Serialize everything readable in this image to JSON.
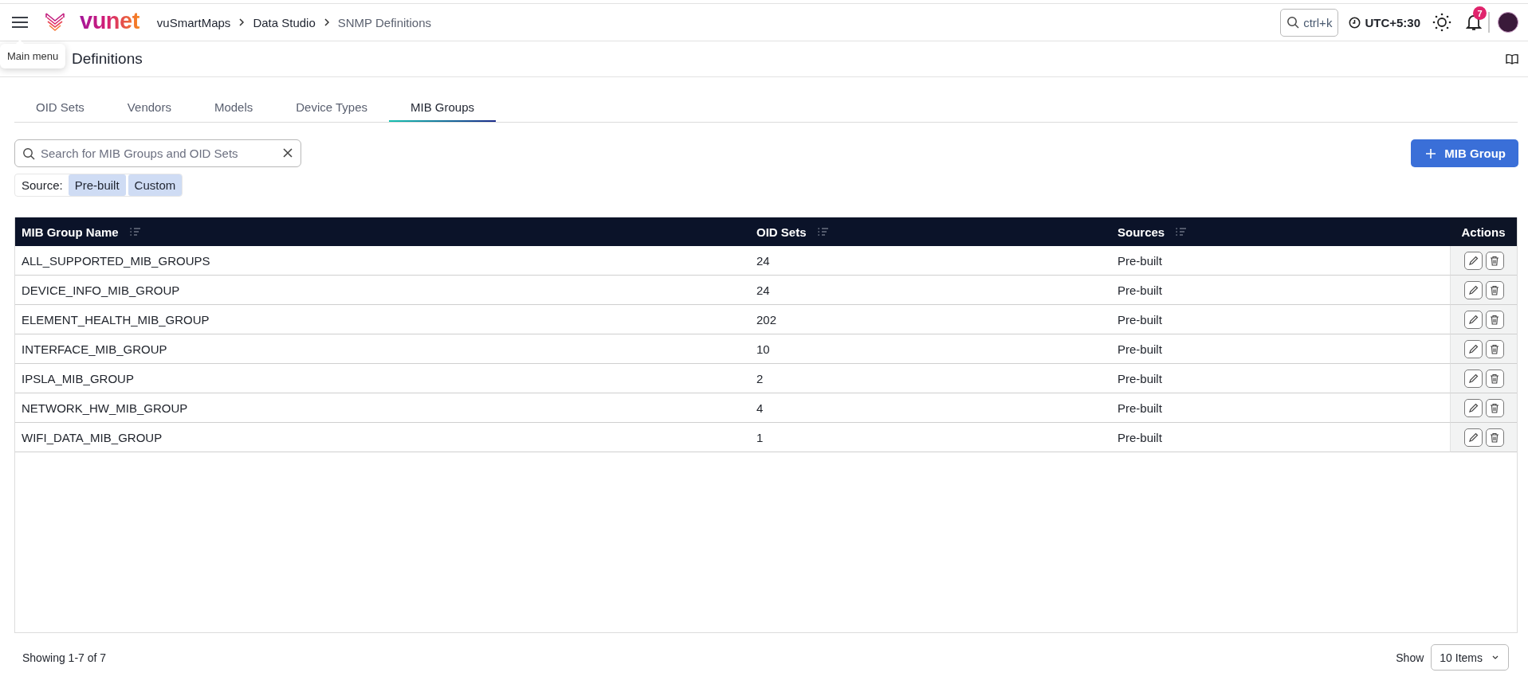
{
  "header": {
    "menu_tooltip": "Main menu",
    "logo": "vunet",
    "breadcrumbs": [
      {
        "label": "vuSmartMaps",
        "current": false
      },
      {
        "label": "Data Studio",
        "current": false
      },
      {
        "label": "SNMP Definitions",
        "current": true
      }
    ],
    "search_shortcut": "ctrl+k",
    "timezone": "UTC+5:30",
    "notification_count": "7"
  },
  "page": {
    "title": "Definitions"
  },
  "tabs": [
    {
      "label": "OID Sets",
      "selected": false
    },
    {
      "label": "Vendors",
      "selected": false
    },
    {
      "label": "Models",
      "selected": false
    },
    {
      "label": "Device Types",
      "selected": false
    },
    {
      "label": "MIB Groups",
      "selected": true
    }
  ],
  "search": {
    "placeholder": "Search for MIB Groups and OID Sets"
  },
  "source_filter": {
    "label": "Source:",
    "options": [
      {
        "label": "Pre-built",
        "selected": true
      },
      {
        "label": "Custom",
        "selected": true
      }
    ]
  },
  "add_button": {
    "label": "MIB Group"
  },
  "table": {
    "columns": [
      {
        "label": "MIB Group Name",
        "sortable": true
      },
      {
        "label": "OID Sets",
        "sortable": true
      },
      {
        "label": "Sources",
        "sortable": true
      },
      {
        "label": "Actions",
        "sortable": false
      }
    ],
    "rows": [
      {
        "cells": [
          "ALL_SUPPORTED_MIB_GROUPS",
          "24",
          "Pre-built"
        ]
      },
      {
        "cells": [
          "DEVICE_INFO_MIB_GROUP",
          "24",
          "Pre-built"
        ]
      },
      {
        "cells": [
          "ELEMENT_HEALTH_MIB_GROUP",
          "202",
          "Pre-built"
        ]
      },
      {
        "cells": [
          "INTERFACE_MIB_GROUP",
          "10",
          "Pre-built"
        ]
      },
      {
        "cells": [
          "IPSLA_MIB_GROUP",
          "2",
          "Pre-built"
        ]
      },
      {
        "cells": [
          "NETWORK_HW_MIB_GROUP",
          "4",
          "Pre-built"
        ]
      },
      {
        "cells": [
          "WIFI_DATA_MIB_GROUP",
          "1",
          "Pre-built"
        ]
      }
    ]
  },
  "footer": {
    "summary": "Showing 1-7 of 7",
    "show_label": "Show",
    "page_size": "10 Items"
  }
}
